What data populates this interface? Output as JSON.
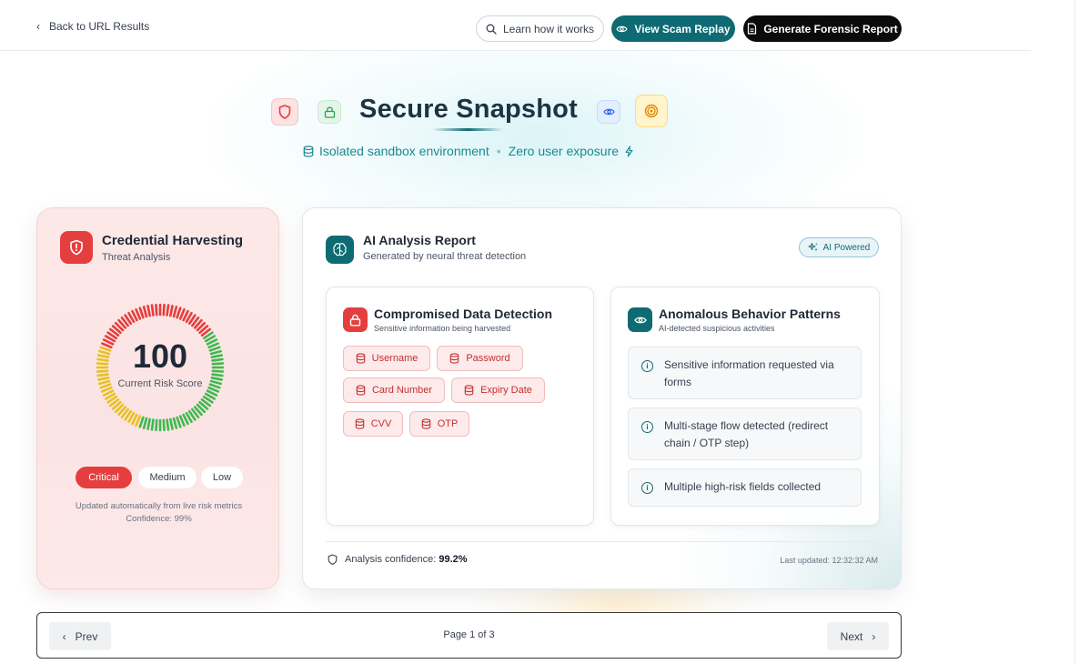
{
  "nav": {
    "back_label": "Back to URL Results",
    "learn_label": "Learn how it works",
    "replay_label": "View Scam Replay",
    "report_label": "Generate Forensic Report"
  },
  "hero": {
    "title": "Secure Snapshot",
    "subtitle_part1": "Isolated sandbox environment",
    "separator": "•",
    "subtitle_part2": "Zero user exposure"
  },
  "risk_card": {
    "title": "Credential Harvesting",
    "subtitle": "Threat Analysis",
    "score": "100",
    "score_value": 100,
    "score_label": "Current Risk Score",
    "levels": [
      "Critical",
      "Medium",
      "Low"
    ],
    "active_level": "Critical",
    "note_line1": "Updated automatically from live risk metrics",
    "note_line2": "Confidence: 99%"
  },
  "analysis": {
    "title": "AI Analysis Report",
    "subtitle": "Generated by neural threat detection",
    "badge": "AI Powered",
    "data_panel": {
      "title": "Compromised Data Detection",
      "subtitle": "Sensitive information being harvested",
      "chips": [
        "Username",
        "Password",
        "Card Number",
        "Expiry Date",
        "CVV",
        "OTP"
      ]
    },
    "behavior_panel": {
      "title": "Anomalous Behavior Patterns",
      "subtitle": "AI-detected suspicious activities",
      "items": [
        "Sensitive information requested via forms",
        "Multi-stage flow detected (redirect chain / OTP step)",
        "Multiple high-risk fields collected"
      ]
    },
    "confidence_label": "Analysis confidence:",
    "confidence_value": "99.2%",
    "last_updated": "Last updated: 12:32:32 AM"
  },
  "pagination": {
    "prev_label": "Prev",
    "next_label": "Next",
    "page_label": "Page 1 of 3"
  },
  "colors": {
    "accent_teal": "#0e6b73",
    "critical_red": "#e53e3e",
    "chip_red": "#c53030",
    "gauge_red": "#e53e3e",
    "gauge_yellow": "#e7c11f",
    "gauge_green": "#3fb950"
  }
}
